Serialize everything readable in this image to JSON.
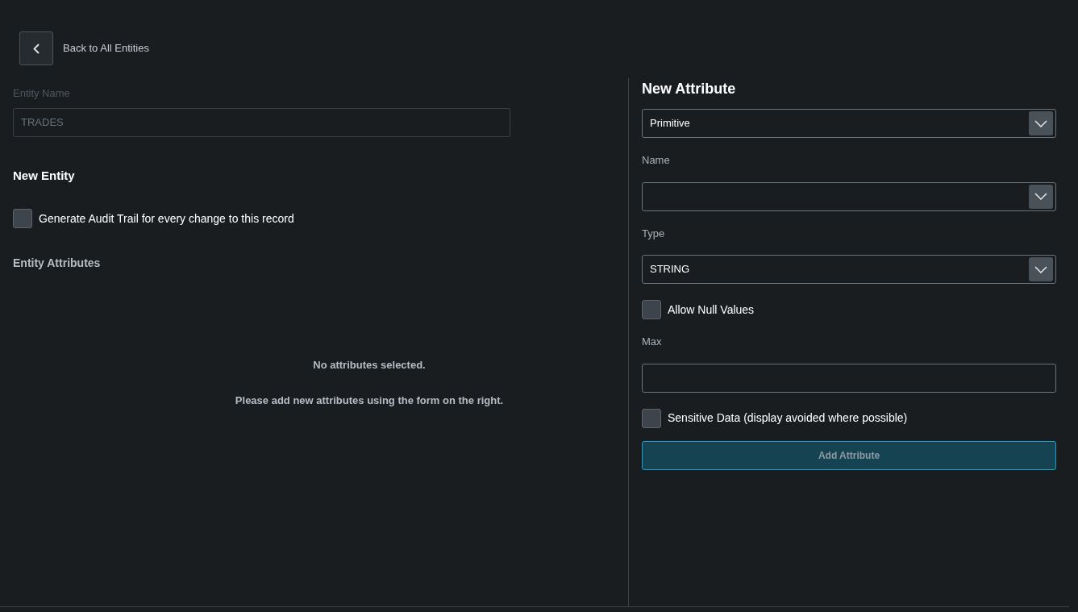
{
  "back": {
    "label": "Back to All Entities"
  },
  "entity_name": {
    "label": "Entity Name",
    "value": "TRADES",
    "disabled": true
  },
  "section_title": "New Entity",
  "audit_trail": {
    "label": "Generate Audit Trail for every change to this record",
    "checked": false
  },
  "attributes_title": "Entity Attributes",
  "empty_state": [
    "No attributes selected.",
    "Please add new attributes using the form on the right."
  ],
  "new_attribute": {
    "title": "New Attribute",
    "fields": [
      {
        "kind": "select",
        "value": "Primitive"
      },
      {
        "kind": "select",
        "label": "Name"
      },
      {
        "kind": "select",
        "label": "Type",
        "value": "STRING"
      },
      {
        "kind": "checkbox",
        "label": "Allow Null Values",
        "checked": false
      },
      {
        "kind": "input",
        "label": "Max"
      },
      {
        "kind": "checkbox",
        "label": "Sensitive Data (display avoided where possible)",
        "checked": false
      }
    ],
    "submit": "Add Attribute"
  }
}
